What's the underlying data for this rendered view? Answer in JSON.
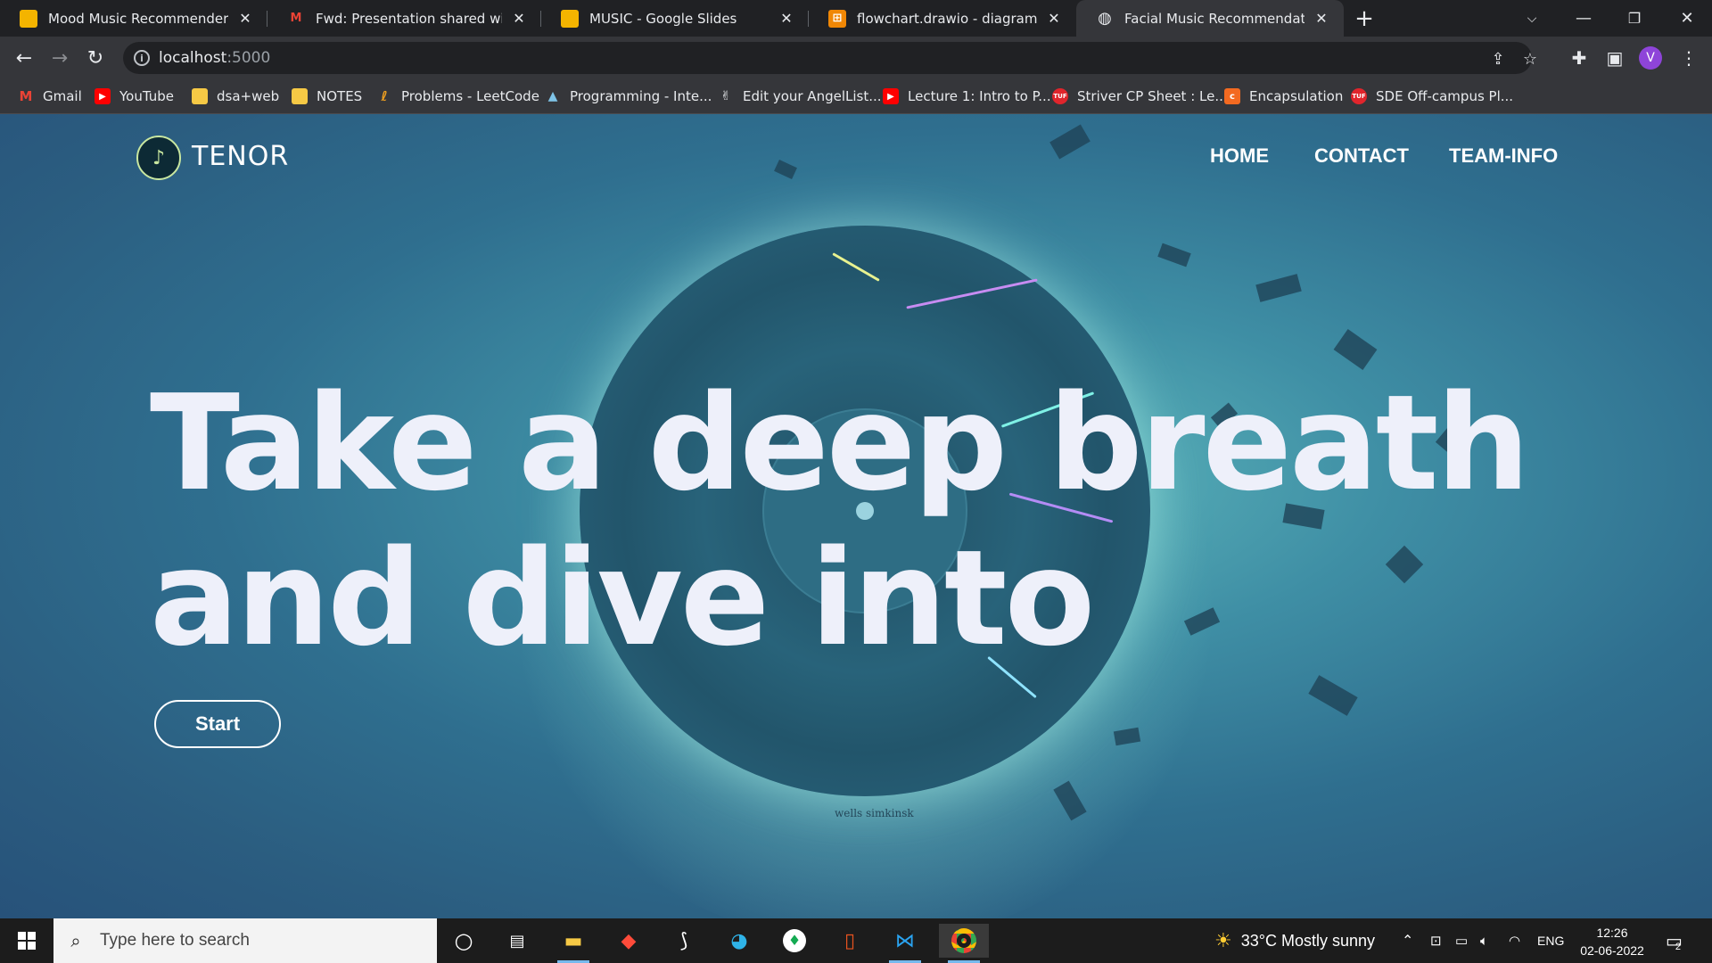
{
  "browser": {
    "tabs": [
      {
        "title": "Mood Music Recommender - Go",
        "icon": "google-slides-icon",
        "active": false
      },
      {
        "title": "Fwd: Presentation shared with yo",
        "icon": "gmail-icon",
        "active": false
      },
      {
        "title": "MUSIC - Google Slides",
        "icon": "google-slides-icon",
        "active": false
      },
      {
        "title": "flowchart.drawio - diagrams.net",
        "icon": "drawio-icon",
        "active": false
      },
      {
        "title": "Facial Music Recommendation",
        "icon": "globe-icon",
        "active": true
      }
    ],
    "url_host": "localhost",
    "url_port": ":5000",
    "profile_initial": "V",
    "bookmarks": [
      {
        "label": "Gmail",
        "icon": "gmail-icon"
      },
      {
        "label": "YouTube",
        "icon": "youtube-icon"
      },
      {
        "label": "dsa+web",
        "icon": "folder-icon"
      },
      {
        "label": "NOTES",
        "icon": "folder-icon"
      },
      {
        "label": "Problems - LeetCode",
        "icon": "leetcode-icon"
      },
      {
        "label": "Programming - Inte...",
        "icon": "mountain-icon"
      },
      {
        "label": "Edit your AngelList...",
        "icon": "angellist-icon"
      },
      {
        "label": "Lecture 1: Intro to P...",
        "icon": "youtube-icon"
      },
      {
        "label": "Striver CP Sheet : Le...",
        "icon": "tuf-icon"
      },
      {
        "label": "Encapsulation",
        "icon": "bookmark-app-icon"
      },
      {
        "label": "SDE Off-campus Pl...",
        "icon": "tuf-icon"
      }
    ]
  },
  "site": {
    "logo_text": "TENOR",
    "logo_badge": "TENOR",
    "nav": [
      "HOME",
      "CONTACT",
      "TEAM-INFO"
    ],
    "hero_line1": "Take a deep breath",
    "hero_line2": "and dive into",
    "start_label": "Start",
    "artist_signature": "wells simkinsk"
  },
  "taskbar": {
    "search_placeholder": "Type here to search",
    "weather": "33°C  Mostly sunny",
    "language": "ENG",
    "time": "12:26",
    "date": "02-06-2022",
    "notification_count": "2"
  },
  "colors": {
    "chrome_dark": "#202124",
    "chrome_toolbar": "#35363a",
    "page_teal": "#3f8fa5",
    "hero_text": "#eef0fa",
    "profile": "#8e44d9"
  }
}
